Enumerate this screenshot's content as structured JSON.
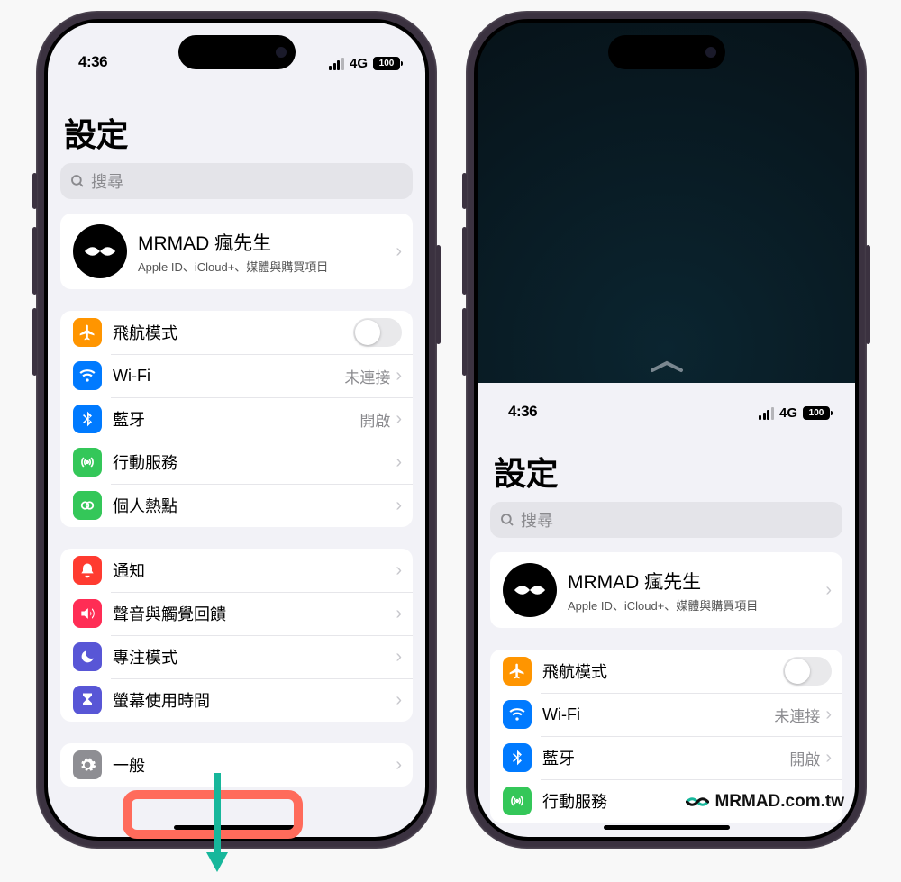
{
  "status": {
    "time": "4:36",
    "network": "4G",
    "battery": "100"
  },
  "page_title": "設定",
  "search_placeholder": "搜尋",
  "apple_id": {
    "name": "MRMAD 瘋先生",
    "subtitle": "Apple ID、iCloud+、媒體與購買項目"
  },
  "groups": [
    {
      "rows": [
        {
          "key": "airplane",
          "label": "飛航模式",
          "type": "toggle",
          "icon_bg": "bg-orange"
        },
        {
          "key": "wifi",
          "label": "Wi-Fi",
          "value": "未連接",
          "type": "link",
          "icon_bg": "bg-blue"
        },
        {
          "key": "bluetooth",
          "label": "藍牙",
          "value": "開啟",
          "type": "link",
          "icon_bg": "bg-blue"
        },
        {
          "key": "cellular",
          "label": "行動服務",
          "type": "link",
          "icon_bg": "bg-green"
        },
        {
          "key": "hotspot",
          "label": "個人熱點",
          "type": "link",
          "icon_bg": "bg-green"
        }
      ]
    },
    {
      "rows": [
        {
          "key": "notifications",
          "label": "通知",
          "type": "link",
          "icon_bg": "bg-red"
        },
        {
          "key": "sounds",
          "label": "聲音與觸覺回饋",
          "type": "link",
          "icon_bg": "bg-pink"
        },
        {
          "key": "focus",
          "label": "專注模式",
          "type": "link",
          "icon_bg": "bg-indigo"
        },
        {
          "key": "screentime",
          "label": "螢幕使用時間",
          "type": "link",
          "icon_bg": "bg-indigo"
        }
      ]
    },
    {
      "rows": [
        {
          "key": "general",
          "label": "一般",
          "type": "link",
          "icon_bg": "bg-gray"
        }
      ]
    }
  ],
  "right_groups": [
    {
      "rows": [
        {
          "key": "airplane",
          "label": "飛航模式",
          "type": "toggle",
          "icon_bg": "bg-orange"
        },
        {
          "key": "wifi",
          "label": "Wi-Fi",
          "value": "未連接",
          "type": "link",
          "icon_bg": "bg-blue"
        },
        {
          "key": "bluetooth",
          "label": "藍牙",
          "value": "開啟",
          "type": "link",
          "icon_bg": "bg-blue"
        },
        {
          "key": "cellular",
          "label": "行動服務",
          "type": "link",
          "icon_bg": "bg-green"
        }
      ]
    }
  ],
  "watermark": "MRMAD.com.tw"
}
